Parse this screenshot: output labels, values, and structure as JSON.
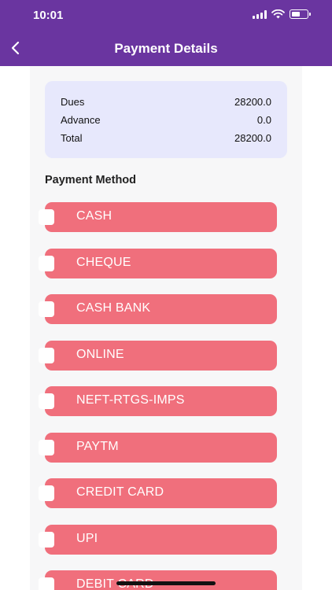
{
  "status_bar": {
    "time": "10:01"
  },
  "header": {
    "title": "Payment Details"
  },
  "summary": {
    "rows": [
      {
        "label": "Dues",
        "value": "28200.0"
      },
      {
        "label": "Advance",
        "value": "0.0"
      },
      {
        "label": "Total",
        "value": "28200.0"
      }
    ]
  },
  "payment_method": {
    "title": "Payment Method",
    "options": [
      {
        "label": "CASH"
      },
      {
        "label": "CHEQUE"
      },
      {
        "label": "CASH BANK"
      },
      {
        "label": "ONLINE"
      },
      {
        "label": "NEFT-RTGS-IMPS"
      },
      {
        "label": "PAYTM"
      },
      {
        "label": "CREDIT CARD"
      },
      {
        "label": "UPI"
      },
      {
        "label": "DEBIT CARD"
      }
    ]
  },
  "colors": {
    "header": "#6a35a0",
    "summary_bg": "#e7e8fc",
    "method_pill": "#f06f7c"
  }
}
